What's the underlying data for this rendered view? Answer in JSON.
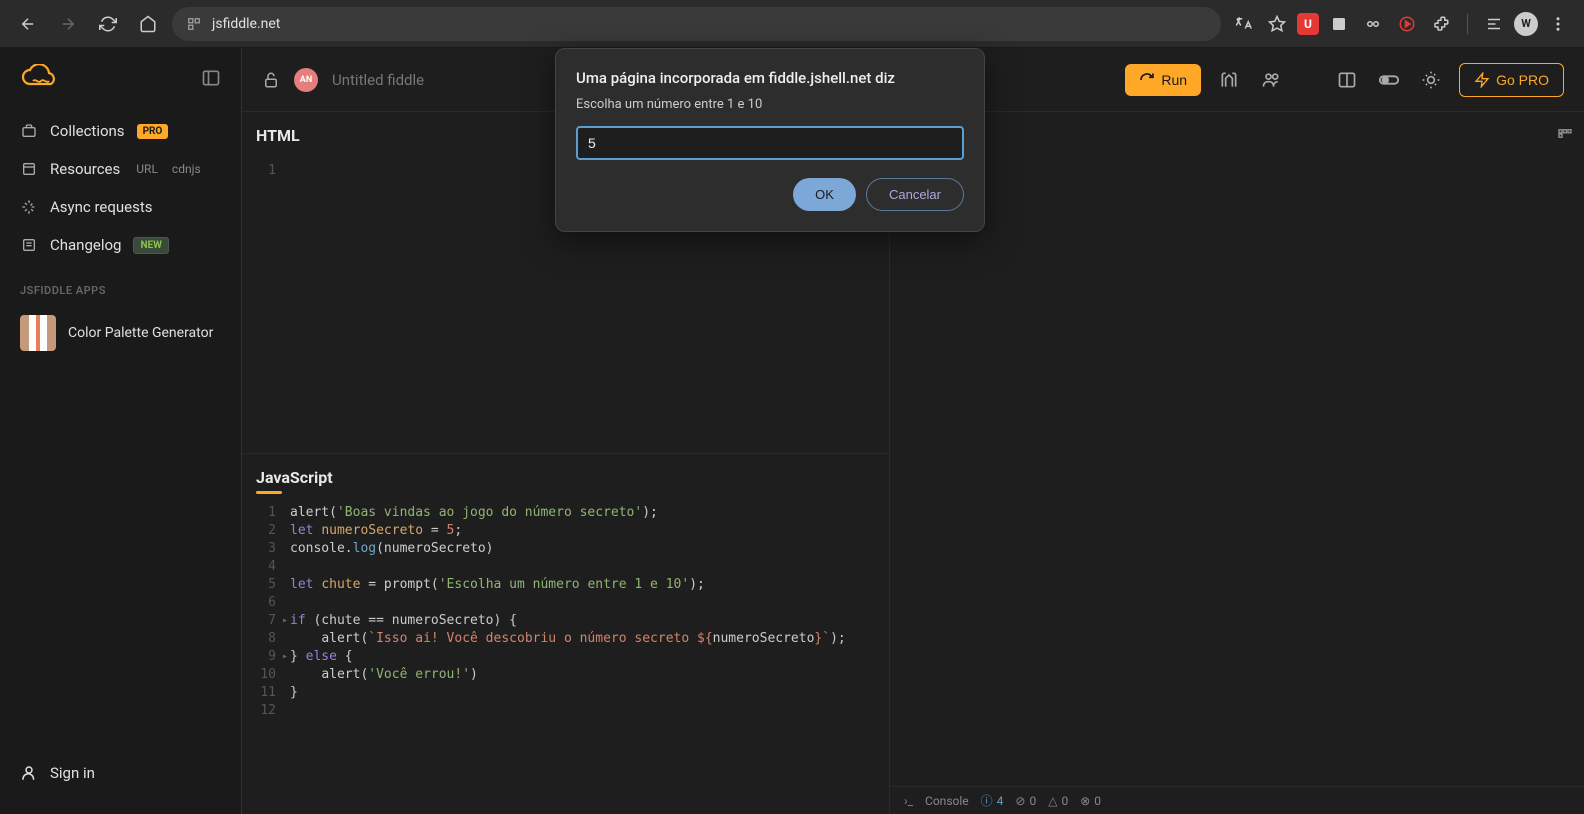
{
  "browser": {
    "url": "jsfiddle.net",
    "ext_u_label": "U",
    "avatar_label": "W"
  },
  "sidebar": {
    "items": [
      {
        "label": "Collections",
        "badge": "PRO"
      },
      {
        "label": "Resources",
        "sub1": "URL",
        "sub2": "cdnjs"
      },
      {
        "label": "Async requests"
      },
      {
        "label": "Changelog",
        "badge": "NEW"
      }
    ],
    "heading": "JSFIDDLE APPS",
    "app1": "Color Palette Generator",
    "signin": "Sign in"
  },
  "topbar": {
    "user_initials": "AN",
    "title": "Untitled fiddle",
    "run": "Run",
    "gopro": "Go PRO"
  },
  "panes": {
    "html_label": "HTML",
    "js_label": "JavaScript"
  },
  "prompt": {
    "title": "Uma página incorporada em fiddle.jshell.net diz",
    "message": "Escolha um número entre 1 e 10",
    "value": "5",
    "ok": "OK",
    "cancel": "Cancelar"
  },
  "console": {
    "label": "Console",
    "info_count": "4",
    "warn_count": "0",
    "err_count": "0",
    "other_count": "0"
  },
  "code": {
    "html_lines": [
      "1"
    ],
    "js": [
      {
        "n": "1",
        "pre": "",
        "t": [
          [
            "",
            "alert("
          ],
          [
            "str",
            "'Boas vindas ao jogo do número secreto'"
          ],
          [
            "",
            ");"
          ]
        ]
      },
      {
        "n": "2",
        "pre": "",
        "t": [
          [
            "kw",
            "let"
          ],
          [
            "",
            " "
          ],
          [
            "var",
            "numeroSecreto"
          ],
          [
            "",
            " = "
          ],
          [
            "num",
            "5"
          ],
          [
            "",
            ";"
          ]
        ]
      },
      {
        "n": "3",
        "pre": "",
        "t": [
          [
            "",
            "console."
          ],
          [
            "fn",
            "log"
          ],
          [
            "",
            "(numeroSecreto)"
          ]
        ]
      },
      {
        "n": "4",
        "pre": "",
        "t": []
      },
      {
        "n": "5",
        "pre": "",
        "t": [
          [
            "kw",
            "let"
          ],
          [
            "",
            " "
          ],
          [
            "var",
            "chute"
          ],
          [
            "",
            " = prompt("
          ],
          [
            "str",
            "'Escolha um número entre 1 e 10'"
          ],
          [
            "",
            ");"
          ]
        ]
      },
      {
        "n": "6",
        "pre": "",
        "t": []
      },
      {
        "n": "7",
        "pre": "",
        "fold": true,
        "t": [
          [
            "kw",
            "if"
          ],
          [
            "",
            " (chute == numeroSecreto) {"
          ]
        ]
      },
      {
        "n": "8",
        "pre": "    ",
        "t": [
          [
            "",
            "alert("
          ],
          [
            "tpl",
            "`Isso ai! Você descobriu o número secreto ${"
          ],
          [
            "",
            "numeroSecreto"
          ],
          [
            "tpl",
            "}`"
          ],
          [
            "",
            ");"
          ]
        ]
      },
      {
        "n": "9",
        "pre": "",
        "fold": true,
        "t": [
          [
            "",
            "} "
          ],
          [
            "kw",
            "else"
          ],
          [
            "",
            " {"
          ]
        ]
      },
      {
        "n": "10",
        "pre": "    ",
        "t": [
          [
            "",
            "alert("
          ],
          [
            "str",
            "'Você errou!'"
          ],
          [
            "",
            ")"
          ]
        ]
      },
      {
        "n": "11",
        "pre": "",
        "t": [
          [
            "",
            "}"
          ]
        ]
      },
      {
        "n": "12",
        "pre": "",
        "t": []
      }
    ]
  }
}
